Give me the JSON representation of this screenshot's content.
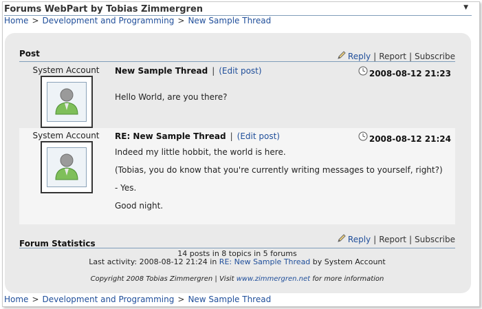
{
  "webpart": {
    "title": "Forums WebPart by Tobias Zimmergren",
    "menu_icon": "▼"
  },
  "breadcrumb": {
    "items": [
      "Home",
      "Development and Programming",
      "New Sample Thread"
    ],
    "separator": ">"
  },
  "post_section": {
    "heading": "Post",
    "actions": {
      "reply": "Reply",
      "report": "Report",
      "subscribe": "Subscribe",
      "separator": "|"
    }
  },
  "posts": [
    {
      "author": "System Account",
      "title": "New Sample Thread",
      "edit": "(Edit post)",
      "date": "2008-08-12 21:23",
      "body": [
        "Hello World, are you there?"
      ]
    },
    {
      "author": "System Account",
      "title": "RE: New Sample Thread",
      "edit": "(Edit post)",
      "date": "2008-08-12 21:24",
      "body": [
        "Indeed my little hobbit, the world is here.",
        "(Tobias, you do know that you're currently writing messages to yourself, right?)",
        "- Yes.",
        "Good night."
      ]
    }
  ],
  "stats": {
    "heading": "Forum Statistics",
    "summary": "14 posts in 8 topics in 5 forums",
    "last_activity_prefix": "Last activity: 2008-08-12 21:24 in",
    "last_activity_thread": "RE: New Sample Thread",
    "last_activity_suffix": "by System Account"
  },
  "copyright": {
    "prefix": "Copyright 2008 Tobias Zimmergren | Visit",
    "link": "www.zimmergren.net",
    "suffix": "for more information"
  },
  "colors": {
    "link": "#1f4e9a",
    "panel": "#eaeaea",
    "rule": "#7f9db9"
  }
}
